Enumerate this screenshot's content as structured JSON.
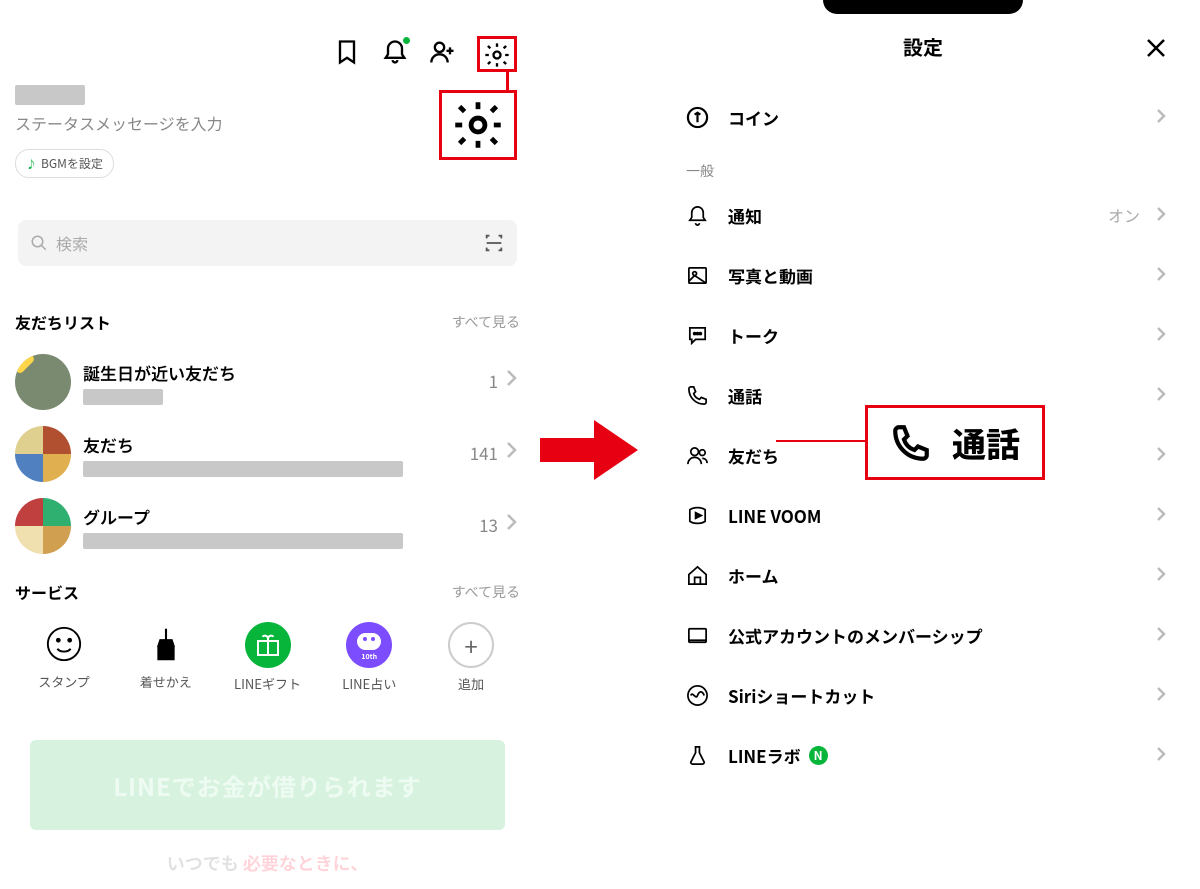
{
  "left": {
    "status_placeholder": "ステータスメッセージを入力",
    "bgm_label": "BGMを設定",
    "search_placeholder": "検索",
    "friend_list": {
      "heading": "友だちリスト",
      "see_all": "すべて見る",
      "items": [
        {
          "title": "誕生日が近い友だち",
          "count": "1"
        },
        {
          "title": "友だち",
          "count": "141"
        },
        {
          "title": "グループ",
          "count": "13"
        }
      ]
    },
    "services": {
      "heading": "サービス",
      "see_all": "すべて見る",
      "items": [
        {
          "label": "スタンプ"
        },
        {
          "label": "着せかえ"
        },
        {
          "label": "LINEギフト"
        },
        {
          "label": "LINE占い",
          "sub": "10th"
        },
        {
          "label": "追加"
        }
      ]
    },
    "banner_text": "LINEでお金が借りられます",
    "banner_sub_gray": "いつでも",
    "banner_sub_pink": "必要なときに、"
  },
  "right": {
    "title": "設定",
    "top_item": {
      "label": "コイン"
    },
    "section_label": "一般",
    "items": [
      {
        "icon": "bell",
        "label": "通知",
        "value": "オン"
      },
      {
        "icon": "image",
        "label": "写真と動画"
      },
      {
        "icon": "chat",
        "label": "トーク"
      },
      {
        "icon": "phone",
        "label": "通話"
      },
      {
        "icon": "friends",
        "label": "友だち"
      },
      {
        "icon": "voom",
        "label": "LINE VOOM"
      },
      {
        "icon": "home",
        "label": "ホーム"
      },
      {
        "icon": "card",
        "label": "公式アカウントのメンバーシップ"
      },
      {
        "icon": "siri",
        "label": "Siriショートカット"
      },
      {
        "icon": "lab",
        "label": "LINEラボ",
        "badge": "N"
      }
    ]
  },
  "callout": {
    "label": "通話"
  }
}
